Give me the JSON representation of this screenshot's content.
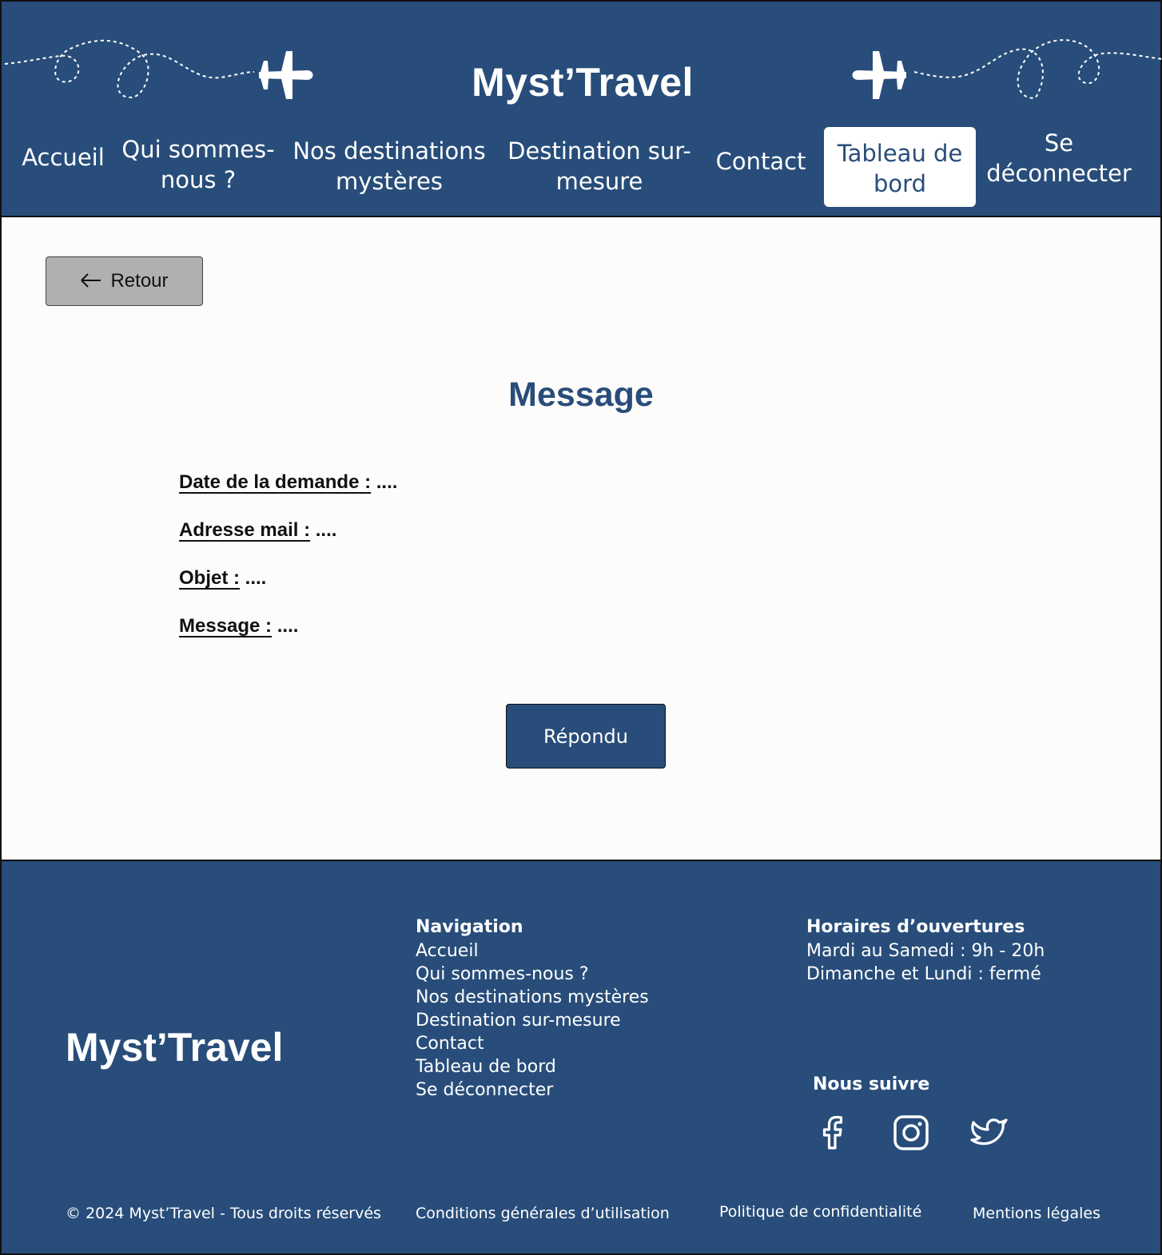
{
  "header": {
    "brand": "Myst’Travel",
    "nav": [
      {
        "label_line1": "Accueil",
        "label_line2": ""
      },
      {
        "label_line1": "Qui sommes-",
        "label_line2": "nous ?"
      },
      {
        "label_line1": "Nos destinations",
        "label_line2": "mystères"
      },
      {
        "label_line1": "Destination sur-",
        "label_line2": "mesure"
      },
      {
        "label_line1": "Contact",
        "label_line2": ""
      },
      {
        "label_line1": "Tableau de",
        "label_line2": "bord"
      },
      {
        "label_line1": "Se",
        "label_line2": "déconnecter"
      }
    ],
    "active_nav": "Tableau de bord",
    "icons": [
      "airplane-icon",
      "airplane-icon"
    ]
  },
  "main": {
    "back_label": "Retour",
    "back_icon": "arrow-left-icon",
    "title": "Message",
    "fields": [
      {
        "label": "Date de la demande :",
        "value": " ...."
      },
      {
        "label": "Adresse mail :",
        "value": " ...."
      },
      {
        "label": "Objet :",
        "value": " ...."
      },
      {
        "label": "Message :",
        "value": " ...."
      }
    ],
    "reply_label": "Répondu"
  },
  "footer": {
    "brand": "Myst’Travel",
    "navigation_title": "Navigation",
    "navigation": [
      "Accueil",
      "Qui sommes-nous ?",
      "Nos destinations mystères",
      "Destination sur-mesure",
      "Contact",
      "Tableau de bord",
      "Se déconnecter"
    ],
    "hours_title": "Horaires d’ouvertures",
    "hours": [
      "Mardi au Samedi : 9h - 20h",
      "Dimanche et Lundi : fermé"
    ],
    "follow_title": "Nous suivre",
    "social_icons": [
      "facebook-icon",
      "instagram-icon",
      "twitter-icon"
    ],
    "copyright": "© 2024 Myst’Travel - Tous droits réservés",
    "cgu": "Conditions générales d’utilisation",
    "privacy": "Politique de confidentialité",
    "legal": "Mentions légales"
  },
  "colors": {
    "primary": "#284d7a",
    "back_button": "#b1b0b0",
    "background": "#fdfcfb"
  }
}
